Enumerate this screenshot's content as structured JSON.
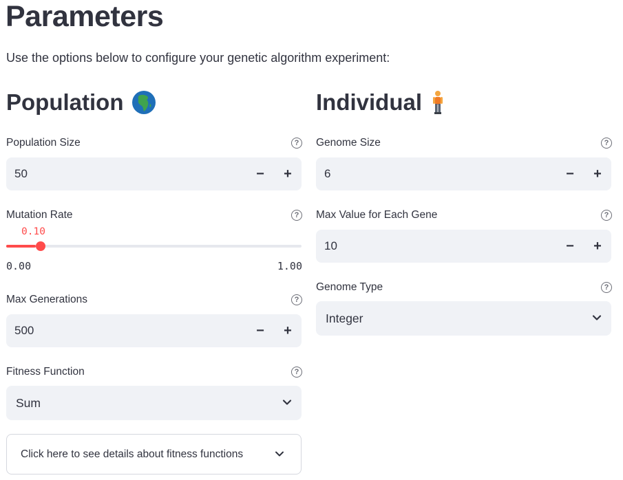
{
  "page": {
    "title": "Parameters",
    "subtitle": "Use the options below to configure your genetic algorithm experiment:"
  },
  "population": {
    "heading": "Population",
    "icon": "globe-africa-icon",
    "population_size": {
      "label": "Population Size",
      "value": "50"
    },
    "mutation_rate": {
      "label": "Mutation Rate",
      "value_text": "0.10",
      "value": 0.1,
      "min": 0.0,
      "max": 1.0,
      "min_label": "0.00",
      "max_label": "1.00"
    },
    "max_generations": {
      "label": "Max Generations",
      "value": "500"
    },
    "fitness_function": {
      "label": "Fitness Function",
      "selected": "Sum"
    },
    "expander": {
      "label": "Click here to see details about fitness functions"
    }
  },
  "individual": {
    "heading": "Individual",
    "icon": "person-standing-icon",
    "genome_size": {
      "label": "Genome Size",
      "value": "6"
    },
    "max_value": {
      "label": "Max Value for Each Gene",
      "value": "10"
    },
    "genome_type": {
      "label": "Genome Type",
      "selected": "Integer"
    }
  },
  "controls": {
    "minus": "−",
    "plus": "+",
    "help": "?"
  },
  "colors": {
    "accent": "#ff4b4b",
    "input_bg": "#f0f2f6",
    "text": "#31333f"
  }
}
